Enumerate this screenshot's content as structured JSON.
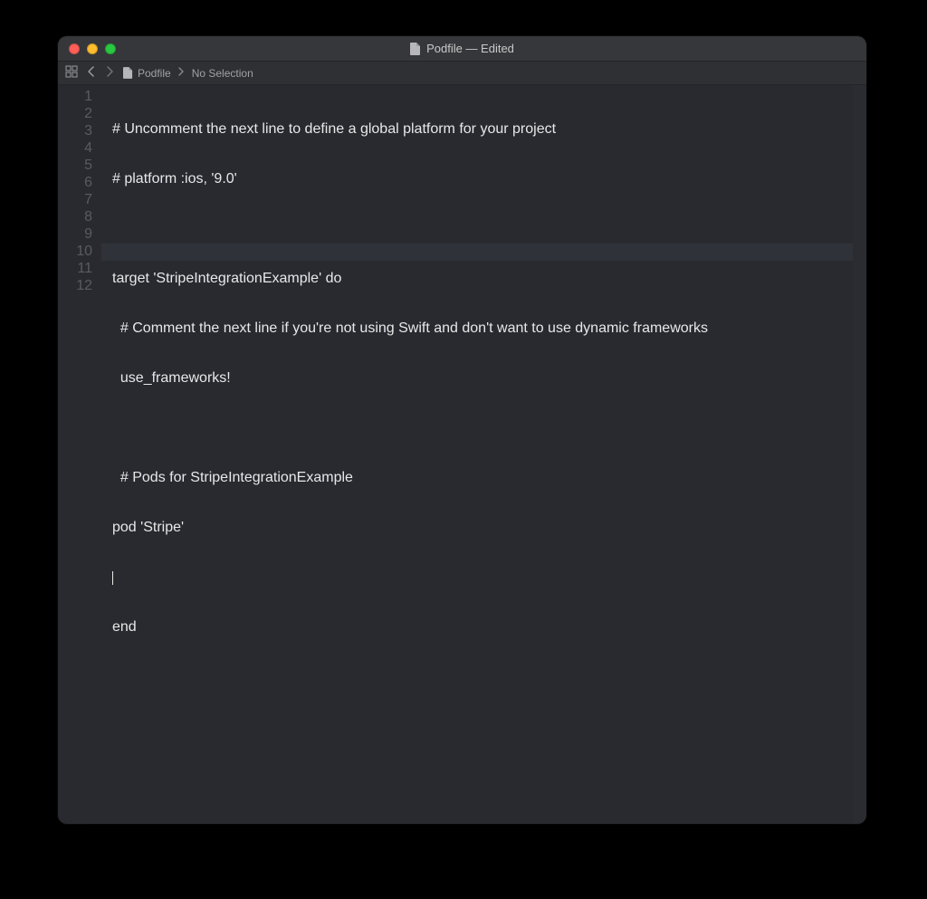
{
  "window": {
    "title": "Podfile — Edited"
  },
  "pathbar": {
    "file": "Podfile",
    "selection": "No Selection"
  },
  "editor": {
    "current_line_index": 9,
    "lines": [
      {
        "n": "1",
        "text": "# Uncomment the next line to define a global platform for your project"
      },
      {
        "n": "2",
        "text": "# platform :ios, '9.0'"
      },
      {
        "n": "3",
        "text": ""
      },
      {
        "n": "4",
        "text": "target 'StripeIntegrationExample' do"
      },
      {
        "n": "5",
        "text": "  # Comment the next line if you're not using Swift and don't want to use dynamic frameworks"
      },
      {
        "n": "6",
        "text": "  use_frameworks!"
      },
      {
        "n": "7",
        "text": ""
      },
      {
        "n": "8",
        "text": "  # Pods for StripeIntegrationExample"
      },
      {
        "n": "9",
        "text": "pod 'Stripe'"
      },
      {
        "n": "10",
        "text": ""
      },
      {
        "n": "11",
        "text": "end"
      },
      {
        "n": "12",
        "text": ""
      }
    ]
  }
}
